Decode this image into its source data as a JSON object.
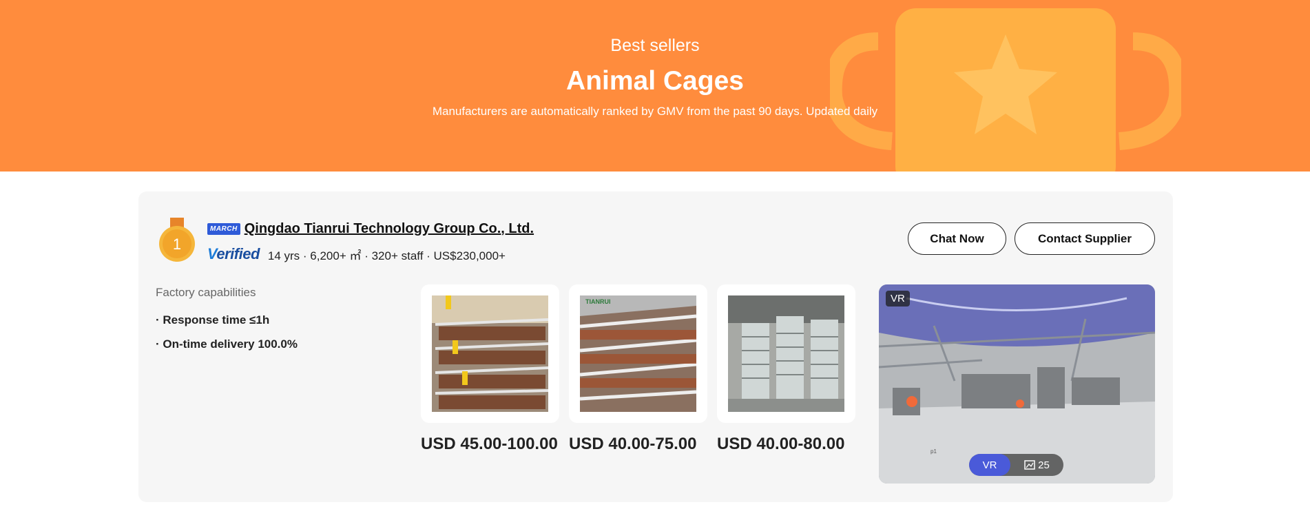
{
  "banner": {
    "subtitle": "Best sellers",
    "title": "Animal Cages",
    "description": "Manufacturers are automatically ranked by GMV from the past 90 days. Updated daily"
  },
  "supplier": {
    "rank": "1",
    "badge": "MARCH",
    "name": "Qingdao Tianrui Technology Group Co., Ltd.",
    "verified_label": "erified",
    "verified_initial": "V",
    "meta": "14 yrs · 6,200+ ㎡ · 320+ staff · US$230,000+",
    "chat_label": "Chat Now",
    "contact_label": "Contact Supplier"
  },
  "capabilities": {
    "title": "Factory capabilities",
    "items": [
      "· Response time ≤1h",
      "· On-time delivery 100.0%"
    ]
  },
  "products": [
    {
      "price": "USD 45.00-100.00"
    },
    {
      "price": "USD 40.00-75.00",
      "watermark": "TIANRUI"
    },
    {
      "price": "USD 40.00-80.00"
    }
  ],
  "vr": {
    "tag": "VR",
    "pill_vr": "VR",
    "photo_count": "25",
    "floor_label": "p1"
  },
  "colors": {
    "banner": "#ff8c3d",
    "accent_blue": "#4a5ad9",
    "medal_gold": "#f2a52a"
  },
  "icons": [
    "medal-icon",
    "image-icon",
    "trophy-graphic"
  ]
}
